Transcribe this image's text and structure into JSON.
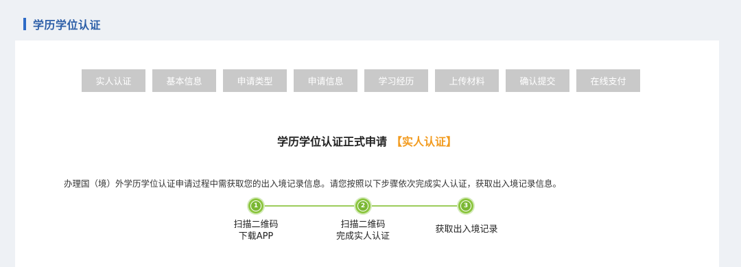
{
  "header": {
    "title": "学历学位认证"
  },
  "tabs": [
    {
      "label": "实人认证"
    },
    {
      "label": "基本信息"
    },
    {
      "label": "申请类型"
    },
    {
      "label": "申请信息"
    },
    {
      "label": "学习经历"
    },
    {
      "label": "上传材料"
    },
    {
      "label": "确认提交"
    },
    {
      "label": "在线支付"
    }
  ],
  "main": {
    "heading": "学历学位认证正式申请",
    "heading_accent": "【实人认证】",
    "description": "办理国（境）外学历学位认证申请过程中需获取您的出入境记录信息。请您按照以下步骤依次完成实人认证，获取出入境记录信息。"
  },
  "progress_steps": [
    {
      "number": "1",
      "line1": "扫描二维码",
      "line2": "下载APP"
    },
    {
      "number": "2",
      "line1": "扫描二维码",
      "line2": "完成实人认证"
    },
    {
      "number": "3",
      "line1": "获取出入境记录",
      "line2": ""
    }
  ],
  "colors": {
    "header_accent": "#2d6bc7",
    "tab_bg": "#c9c9c9",
    "heading_accent": "#f29b1f",
    "step_green": "#8cc63f"
  }
}
